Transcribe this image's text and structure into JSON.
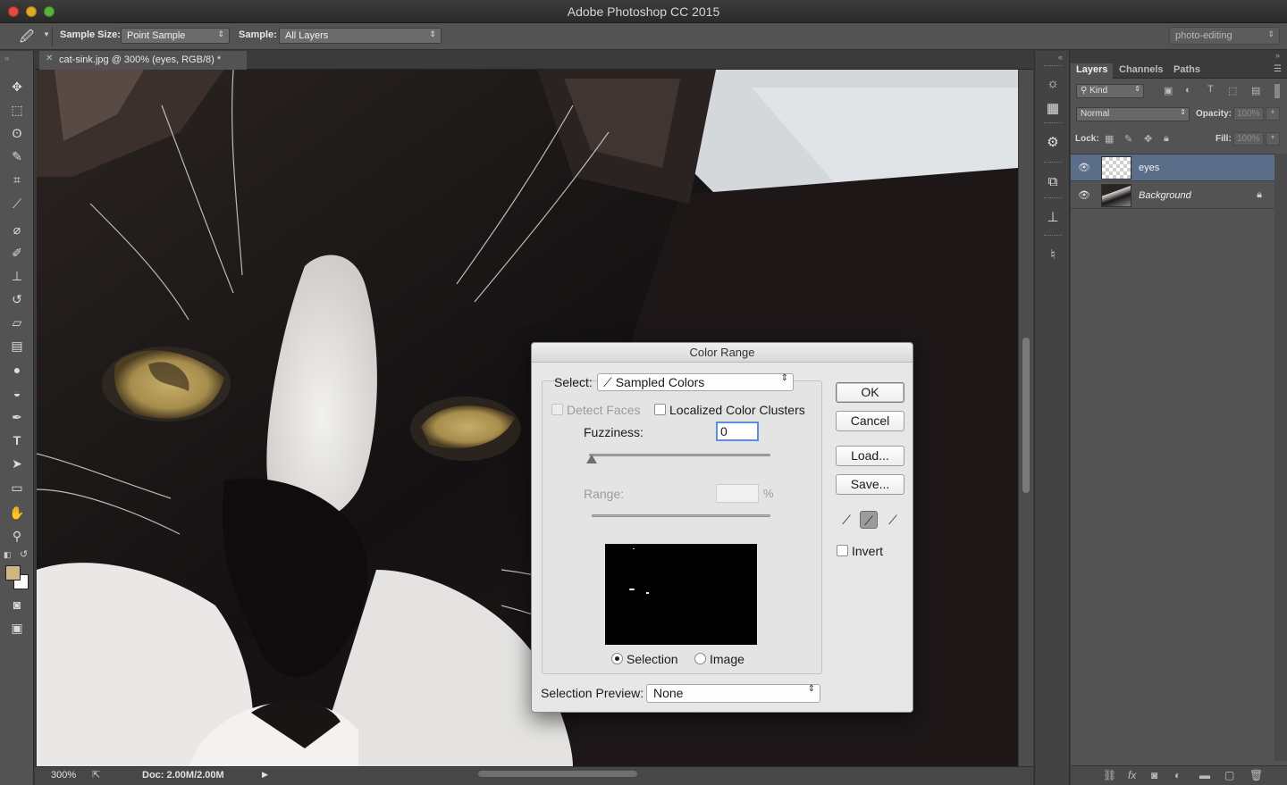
{
  "window": {
    "title": "Adobe Photoshop CC 2015"
  },
  "options_bar": {
    "sample_size_label": "Sample Size:",
    "sample_size_value": "Point Sample",
    "sample_label": "Sample:",
    "sample_value": "All Layers",
    "workspace": "photo-editing"
  },
  "toolbar": {
    "tools": [
      "move-tool",
      "marquee-tool",
      "lasso-tool",
      "quick-selection-tool",
      "crop-tool",
      "eyedropper-tool",
      "healing-brush-tool",
      "brush-tool",
      "clone-stamp-tool",
      "history-brush-tool",
      "eraser-tool",
      "gradient-tool",
      "blur-tool",
      "dodge-tool",
      "pen-tool",
      "type-tool",
      "path-selection-tool",
      "rectangle-tool",
      "hand-tool",
      "zoom-tool"
    ],
    "foreground_color": "#d1b682",
    "background_color": "#ffffff"
  },
  "document": {
    "tab_title": "cat-sink.jpg @ 300% (eyes, RGB/8) *",
    "zoom": "300%",
    "doc_size": "Doc: 2.00M/2.00M"
  },
  "layers_panel": {
    "tabs": [
      "Layers",
      "Channels",
      "Paths"
    ],
    "filter_kind": "Kind",
    "blend_mode": "Normal",
    "opacity_label": "Opacity:",
    "opacity_value": "100%",
    "lock_label": "Lock:",
    "fill_label": "Fill:",
    "fill_value": "100%",
    "layers": [
      {
        "name": "eyes",
        "selected": true,
        "locked": false
      },
      {
        "name": "Background",
        "selected": false,
        "locked": true
      }
    ]
  },
  "color_range_dialog": {
    "title": "Color Range",
    "select_label": "Select:",
    "select_value": "Sampled Colors",
    "detect_faces_label": "Detect Faces",
    "detect_faces_checked": false,
    "localized_label": "Localized Color Clusters",
    "localized_checked": false,
    "fuzziness_label": "Fuzziness:",
    "fuzziness_value": "0",
    "range_label": "Range:",
    "range_unit": "%",
    "view_selection_label": "Selection",
    "view_image_label": "Image",
    "view_mode": "Selection",
    "selection_preview_label": "Selection Preview:",
    "selection_preview_value": "None",
    "buttons": {
      "ok": "OK",
      "cancel": "Cancel",
      "load": "Load...",
      "save": "Save..."
    },
    "invert_label": "Invert",
    "invert_checked": false
  }
}
